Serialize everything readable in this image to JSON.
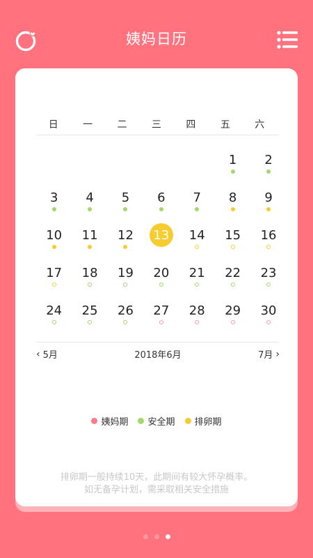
{
  "header": {
    "title": "姨妈日历"
  },
  "calendar": {
    "weekdays": [
      "日",
      "一",
      "二",
      "三",
      "四",
      "五",
      "六"
    ],
    "today": 13,
    "weeks": [
      [
        null,
        null,
        null,
        null,
        null,
        {
          "d": "1",
          "s": "safe"
        },
        {
          "d": "2",
          "s": "safe"
        }
      ],
      [
        {
          "d": "3",
          "s": "safe"
        },
        {
          "d": "4",
          "s": "safe"
        },
        {
          "d": "5",
          "s": "safe"
        },
        {
          "d": "6",
          "s": "safe"
        },
        {
          "d": "7",
          "s": "safe"
        },
        {
          "d": "8",
          "s": "ovu"
        },
        {
          "d": "9",
          "s": "ovu"
        }
      ],
      [
        {
          "d": "10",
          "s": "ovu"
        },
        {
          "d": "11",
          "s": "ovu"
        },
        {
          "d": "12",
          "s": "ovu"
        },
        {
          "d": "13",
          "s": "today"
        },
        {
          "d": "14",
          "s": "ovu",
          "f": true
        },
        {
          "d": "15",
          "s": "ovu",
          "f": true
        },
        {
          "d": "16",
          "s": "ovu",
          "f": true
        }
      ],
      [
        {
          "d": "17",
          "s": "ovu",
          "f": true
        },
        {
          "d": "18",
          "s": "safe",
          "f": true
        },
        {
          "d": "19",
          "s": "safe",
          "f": true
        },
        {
          "d": "20",
          "s": "safe",
          "f": true
        },
        {
          "d": "21",
          "s": "safe",
          "f": true
        },
        {
          "d": "22",
          "s": "safe",
          "f": true
        },
        {
          "d": "23",
          "s": "safe",
          "f": true
        }
      ],
      [
        {
          "d": "24",
          "s": "safe",
          "f": true
        },
        {
          "d": "25",
          "s": "safe",
          "f": true
        },
        {
          "d": "26",
          "s": "safe",
          "f": true
        },
        {
          "d": "27",
          "s": "period",
          "f": true
        },
        {
          "d": "28",
          "s": "period",
          "f": true
        },
        {
          "d": "29",
          "s": "period",
          "f": true
        },
        {
          "d": "30",
          "s": "period",
          "f": true
        }
      ]
    ]
  },
  "nav": {
    "prev_label": "5月",
    "current_label": "2018年6月",
    "next_label": "7月"
  },
  "legend": {
    "period": "姨妈期",
    "safe": "安全期",
    "ovulation": "排卵期"
  },
  "note": {
    "line1": "排卵期一般持续10天，此期间有较大怀孕概率。",
    "line2": "如无备孕计划，需采取相关安全措施"
  },
  "pager": {
    "count": 3,
    "active_index": 2
  },
  "colors": {
    "background": "#ff727e",
    "period": "#ff7a88",
    "safe": "#a3d86a",
    "ovulation": "#f7cc2e"
  }
}
